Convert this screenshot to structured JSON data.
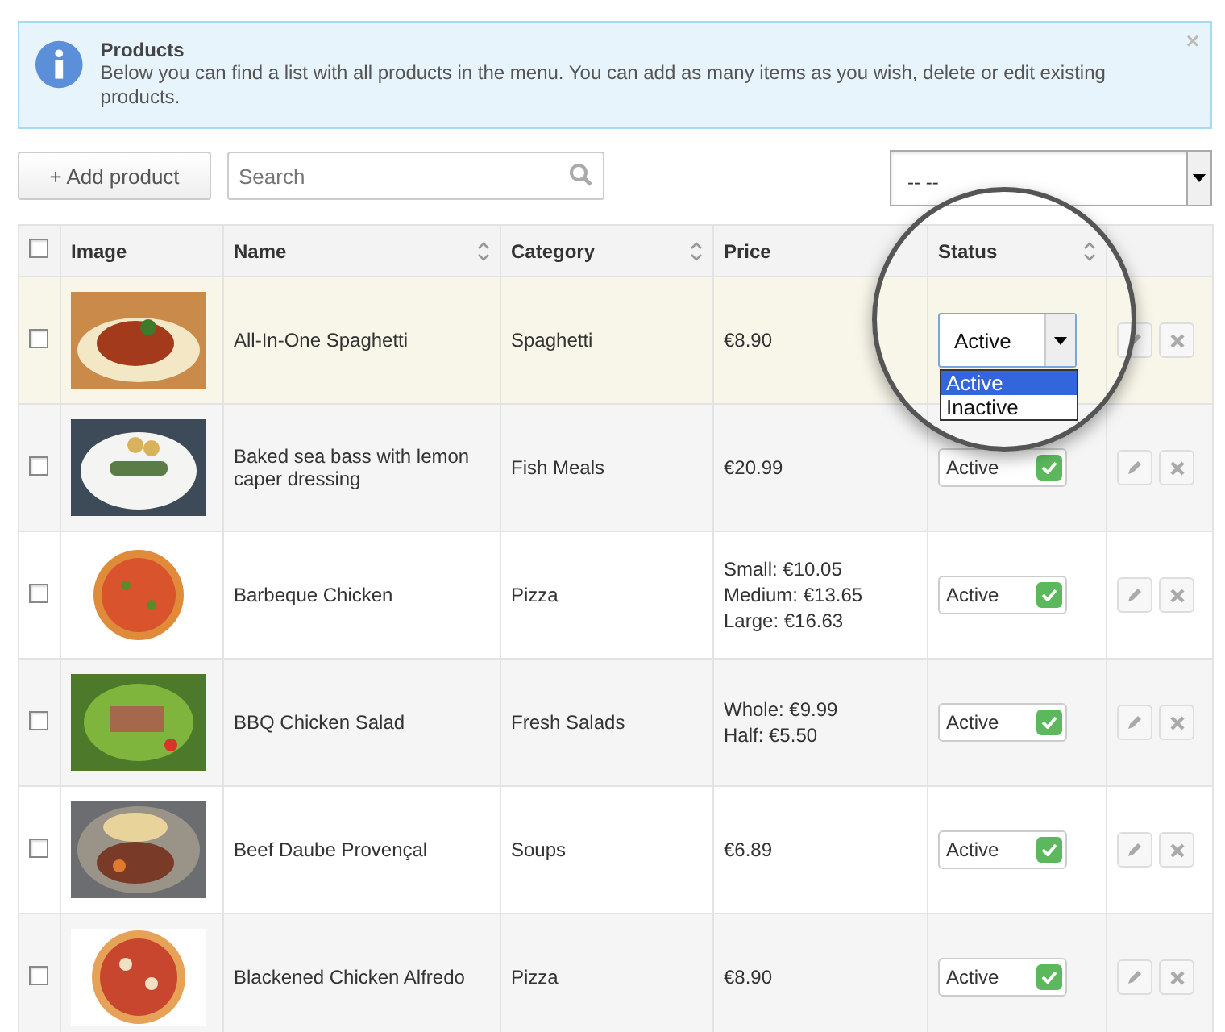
{
  "notice": {
    "title": "Products",
    "text": "Below you can find a list with all products in the menu. You can add as many items as you wish, delete or edit existing products.",
    "close": "×"
  },
  "toolbar": {
    "add_button": "+ Add product",
    "search": {
      "placeholder": "Search"
    },
    "filter_select": {
      "value": "-- --"
    }
  },
  "table": {
    "select_all": {
      "checked": false
    },
    "columns": [
      {
        "label": "Image",
        "sortable": false
      },
      {
        "label": "Name",
        "sortable": true
      },
      {
        "label": "Category",
        "sortable": true
      },
      {
        "label": "Price",
        "sortable": false
      },
      {
        "label": "Status",
        "sortable": true
      }
    ],
    "rows": [
      {
        "checked": false,
        "highlighted": true,
        "name": "All-In-One Spaghetti",
        "category": "Spaghetti",
        "price": [
          "€8.90"
        ],
        "status": {
          "kind": "select",
          "value": "Active",
          "options": [
            {
              "label": "Active",
              "selected": true
            },
            {
              "label": "Inactive",
              "selected": false
            }
          ]
        }
      },
      {
        "checked": false,
        "highlighted": false,
        "name": "Baked sea bass with lemon caper dressing",
        "category": "Fish Meals",
        "price": [
          "€20.99"
        ],
        "status": {
          "kind": "toggle",
          "value": "Active",
          "on": true
        }
      },
      {
        "checked": false,
        "highlighted": false,
        "name": "Barbeque Chicken",
        "category": "Pizza",
        "price": [
          "Small: €10.05",
          "Medium: €13.65",
          "Large: €16.63"
        ],
        "status": {
          "kind": "toggle",
          "value": "Active",
          "on": true
        }
      },
      {
        "checked": false,
        "highlighted": false,
        "name": "BBQ Chicken Salad",
        "category": "Fresh Salads",
        "price": [
          "Whole: €9.99",
          "Half: €5.50"
        ],
        "status": {
          "kind": "toggle",
          "value": "Active",
          "on": true
        }
      },
      {
        "checked": false,
        "highlighted": false,
        "name": "Beef Daube Provençal",
        "category": "Soups",
        "price": [
          "€6.89"
        ],
        "status": {
          "kind": "toggle",
          "value": "Active",
          "on": true
        }
      },
      {
        "checked": false,
        "highlighted": false,
        "name": "Blackened Chicken Alfredo",
        "category": "Pizza",
        "price": [
          "€8.90"
        ],
        "status": {
          "kind": "toggle",
          "value": "Active",
          "on": true
        }
      }
    ]
  }
}
